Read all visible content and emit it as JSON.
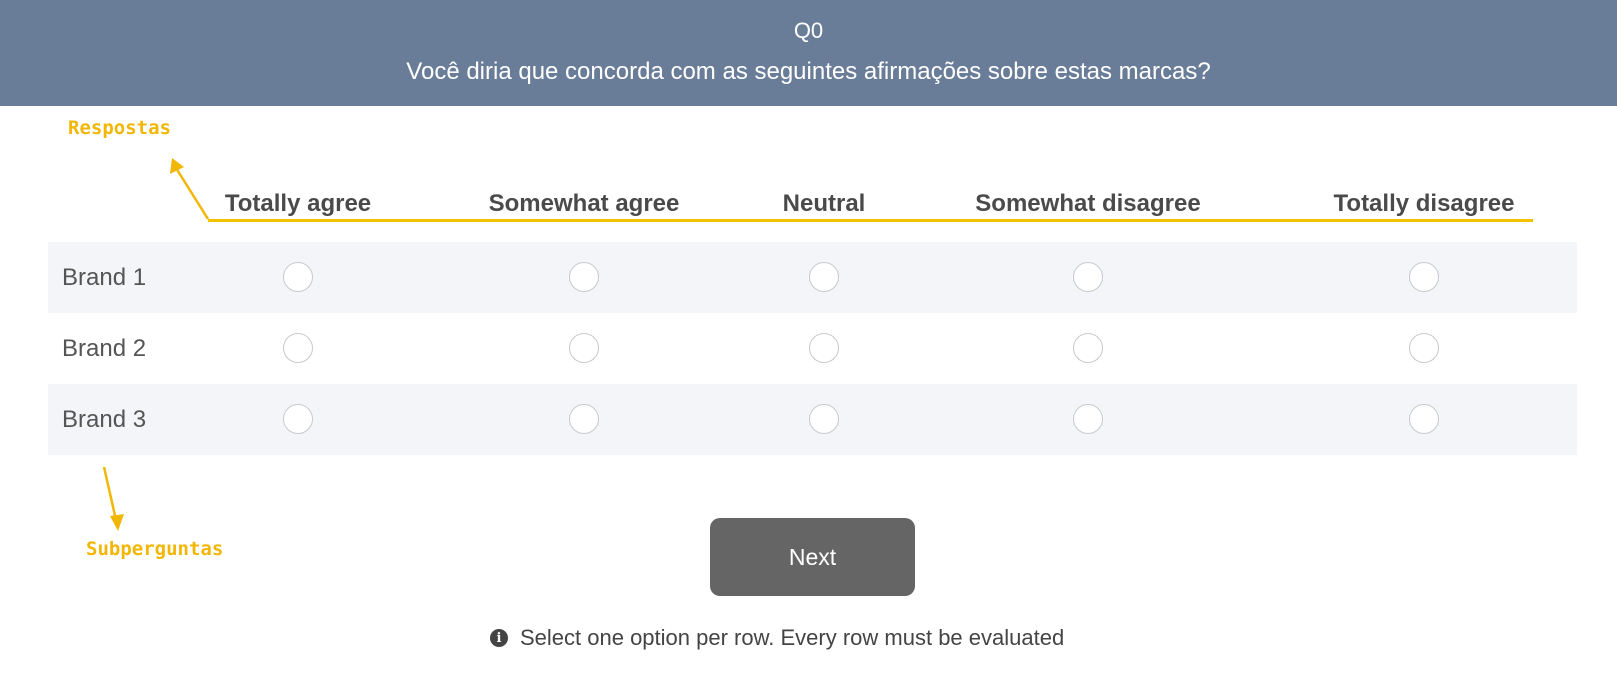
{
  "header": {
    "question_id": "Q0",
    "question_text": "Você diria que concorda com as seguintes afirmações sobre estas marcas?"
  },
  "annotations": {
    "responses_label": "Respostas",
    "subquestions_label": "Subperguntas",
    "color": "#f2b705"
  },
  "columns": [
    "Totally agree",
    "Somewhat agree",
    "Neutral",
    "Somewhat disagree",
    "Totally disagree"
  ],
  "rows": [
    {
      "label": "Brand 1",
      "selected": null
    },
    {
      "label": "Brand 2",
      "selected": null
    },
    {
      "label": "Brand 3",
      "selected": null
    }
  ],
  "actions": {
    "next_label": "Next"
  },
  "hint": {
    "icon": "info-icon",
    "text": "Select one option per row. Every row must be evaluated"
  },
  "colors": {
    "header_bg": "#6a7d98",
    "button_bg": "#656565",
    "row_alt_bg": "#f4f5f8",
    "accent": "#f2c200"
  }
}
